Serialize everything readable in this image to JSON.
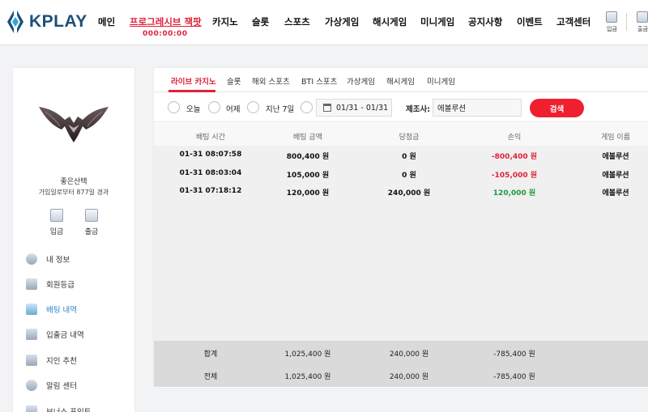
{
  "header": {
    "logo_text": "KPLAY",
    "nav": [
      {
        "label": "메인"
      },
      {
        "label": "프로그레시브 잭팟"
      },
      {
        "label": "카지노"
      },
      {
        "label": "슬롯"
      },
      {
        "label": "스포츠"
      },
      {
        "label": "가상게임"
      },
      {
        "label": "해시게임"
      },
      {
        "label": "미니게임"
      },
      {
        "label": "공지사항"
      },
      {
        "label": "이벤트"
      },
      {
        "label": "고객센터"
      }
    ],
    "jackpot_value": "000:00:00",
    "deposit_label": "입금",
    "withdraw_label": "출금",
    "accent_color": "#e0223a",
    "brand_color": "#1c4f7c"
  },
  "sidebar": {
    "user_name": "좋은산택",
    "user_meta": "가입일로부터 877일 경과",
    "quick_actions": [
      {
        "label": "입금",
        "icon": "wallet-deposit-icon"
      },
      {
        "label": "출금",
        "icon": "wallet-withdraw-icon"
      }
    ],
    "menu": [
      {
        "label": "내 정보",
        "icon": "user-icon"
      },
      {
        "label": "회원등급",
        "icon": "grade-icon"
      },
      {
        "label": "배팅 내역",
        "icon": "betting-history-icon",
        "active": true
      },
      {
        "label": "입출금 내역",
        "icon": "transaction-icon"
      },
      {
        "label": "지인 추천",
        "icon": "referral-icon"
      },
      {
        "label": "알림 센터",
        "icon": "notification-icon"
      },
      {
        "label": "보너스 포인트",
        "icon": "bonus-icon"
      }
    ]
  },
  "tabs": [
    {
      "label": "라이브 카지노",
      "active": true
    },
    {
      "label": "슬롯"
    },
    {
      "label": "해외 스포츠"
    },
    {
      "label": "BTI 스포츠"
    },
    {
      "label": "가상게임"
    },
    {
      "label": "해시게임"
    },
    {
      "label": "미니게임"
    }
  ],
  "filter": {
    "radios": [
      {
        "label": "오늘"
      },
      {
        "label": "어제"
      },
      {
        "label": "지난 7일"
      }
    ],
    "date_range": "01/31 - 01/31",
    "provider_label": "제조사:",
    "provider_value": "에볼루션",
    "search_label": "검색"
  },
  "table": {
    "columns": [
      "배팅 시간",
      "배팅 금액",
      "당첨금",
      "손익",
      "게임 이름"
    ],
    "rows": [
      {
        "time": "01-31 08:07:58",
        "amount": "800,400 원",
        "win": "0 원",
        "profit": "-800,400 원",
        "game": "에볼루션",
        "profit_sign": "neg"
      },
      {
        "time": "01-31 08:03:04",
        "amount": "105,000 원",
        "win": "0 원",
        "profit": "-105,000 원",
        "game": "에볼루션",
        "profit_sign": "neg"
      },
      {
        "time": "01-31 07:18:12",
        "amount": "120,000 원",
        "win": "240,000 원",
        "profit": "120,000 원",
        "game": "에볼루션",
        "profit_sign": "pos"
      }
    ],
    "totals": [
      {
        "label": "합계",
        "amount": "1,025,400 원",
        "win": "240,000 원",
        "profit": "-785,400 원"
      },
      {
        "label": "전체",
        "amount": "1,025,400 원",
        "win": "240,000 원",
        "profit": "-785,400 원"
      }
    ]
  }
}
